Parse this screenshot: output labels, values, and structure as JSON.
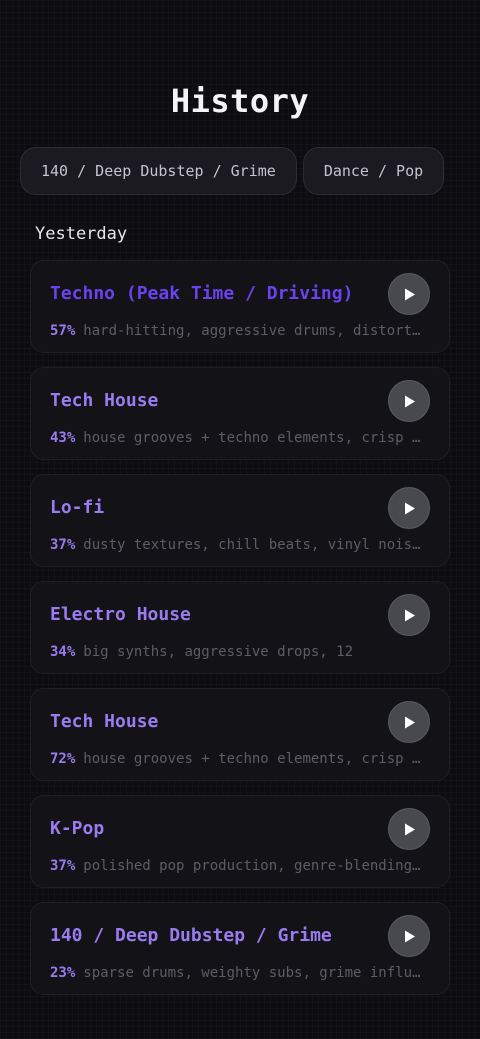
{
  "header": {
    "title": "History"
  },
  "filters": [
    {
      "label": "140 / Deep Dubstep / Grime"
    },
    {
      "label": "Dance / Pop"
    }
  ],
  "section": {
    "label": "Yesterday"
  },
  "items": [
    {
      "title": "Techno (Peak Time / Driving)",
      "percent": "57%",
      "description": "hard-hitting, aggressive drums, distorted synths, dark atmosphere",
      "active": true
    },
    {
      "title": "Tech House",
      "percent": "43%",
      "description": "house grooves + techno elements, crisp percussion"
    },
    {
      "title": "Lo-fi",
      "percent": "37%",
      "description": "dusty textures, chill beats, vinyl noise, mellow keys"
    },
    {
      "title": "Electro House",
      "percent": "34%",
      "description": "big synths, aggressive drops, 12"
    },
    {
      "title": "Tech House",
      "percent": "72%",
      "description": "house grooves + techno elements, crisp percussion"
    },
    {
      "title": "K-Pop",
      "percent": "37%",
      "description": "polished pop production, genre-blending arrangements"
    },
    {
      "title": "140 / Deep Dubstep / Grime",
      "percent": "23%",
      "description": "sparse drums, weighty subs, grime influences"
    }
  ],
  "colors": {
    "accent": "#9a7cf0",
    "accent_active": "#6a42ee",
    "background": "#0d0d11",
    "card": "#121217"
  },
  "icons": {
    "play": "play-icon"
  }
}
